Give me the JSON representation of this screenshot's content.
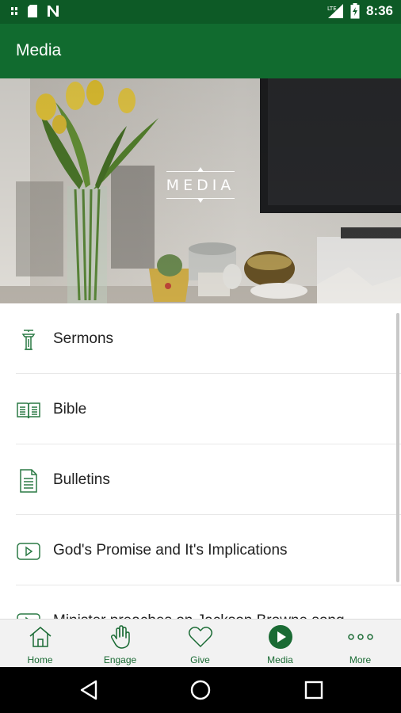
{
  "status_bar": {
    "time": "8:36",
    "left_icons": [
      "notification-icon",
      "sd-card-icon",
      "n-app-icon"
    ],
    "right_icons": [
      "lte-signal-icon",
      "battery-icon"
    ]
  },
  "app_bar": {
    "title": "Media"
  },
  "hero": {
    "label": "MEDIA"
  },
  "list": {
    "items": [
      {
        "label": "Sermons",
        "icon": "podium-icon"
      },
      {
        "label": "Bible",
        "icon": "book-icon"
      },
      {
        "label": "Bulletins",
        "icon": "document-icon"
      },
      {
        "label": "God's Promise and It's Implications",
        "icon": "play-video-icon"
      },
      {
        "label": "Minister preaches on Jackson Browne song",
        "icon": "play-video-icon"
      }
    ]
  },
  "bottom_nav": {
    "items": [
      {
        "label": "Home",
        "icon": "home-icon",
        "active": false
      },
      {
        "label": "Engage",
        "icon": "hand-icon",
        "active": false
      },
      {
        "label": "Give",
        "icon": "heart-icon",
        "active": false
      },
      {
        "label": "Media",
        "icon": "play-circle-icon",
        "active": true
      },
      {
        "label": "More",
        "icon": "more-dots-icon",
        "active": false
      }
    ]
  },
  "colors": {
    "primary": "#116b2f",
    "status_bar": "#0d5a26",
    "accent": "#1a6b34"
  }
}
